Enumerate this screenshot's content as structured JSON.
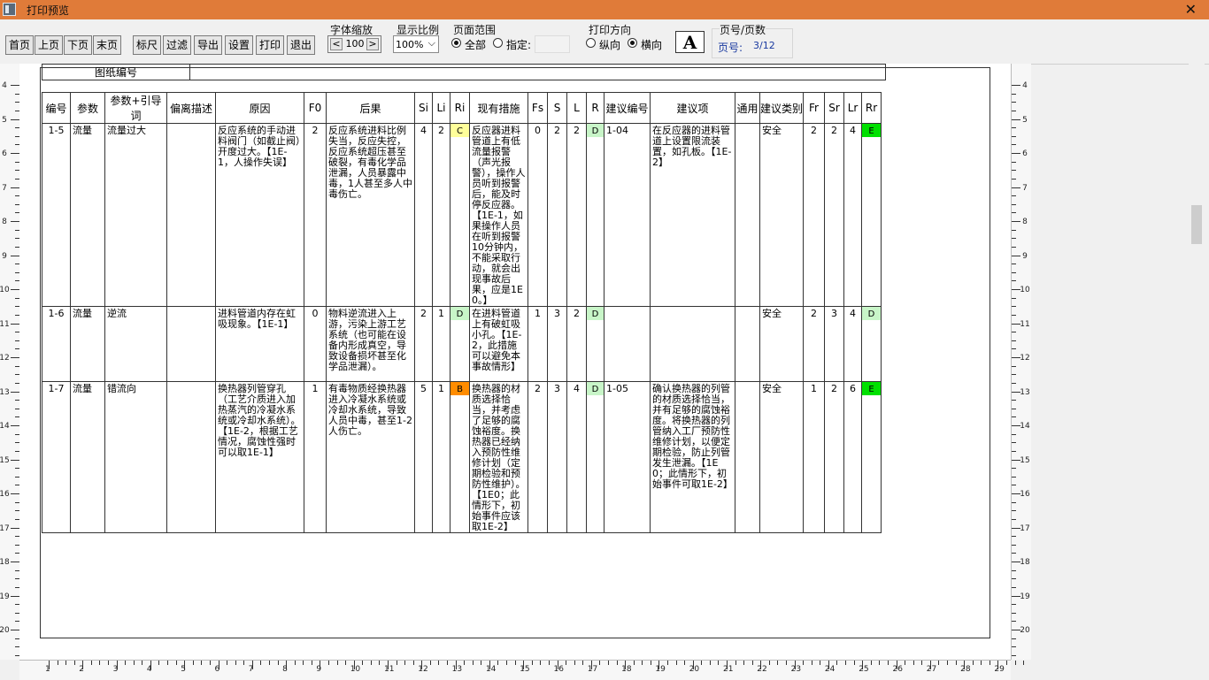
{
  "window": {
    "title": "打印预览"
  },
  "toolbar": {
    "buttons": [
      "首页",
      "上页",
      "下页",
      "末页",
      "标尺",
      "过滤",
      "导出",
      "设置",
      "打印",
      "退出"
    ],
    "font_scale": {
      "label": "字体缩放",
      "minus": "<",
      "value": "100",
      "plus": ">"
    },
    "zoom": {
      "label": "显示比例",
      "value": "100%"
    },
    "page_range": {
      "label": "页面范围",
      "all": "全部",
      "specified": "指定:",
      "specified_value": ""
    },
    "orientation": {
      "label": "打印方向",
      "portrait": "纵向",
      "landscape": "横向",
      "selected": "横向"
    },
    "font_icon": "A",
    "pages": {
      "label": "页号/页数",
      "key": "页号:",
      "value": "3/12"
    }
  },
  "drawing_no_label": "图纸编号",
  "columns": [
    "编号",
    "参数",
    "参数+引导词",
    "偏离描述",
    "原因",
    "F0",
    "后果",
    "Si",
    "Li",
    "Ri",
    "现有措施",
    "Fs",
    "S",
    "L",
    "R",
    "建议编号",
    "建议项",
    "通用",
    "建议类别",
    "Fr",
    "Sr",
    "Lr",
    "Rr"
  ],
  "rows": [
    {
      "id": "1-5",
      "param": "流量",
      "guide": "流量过大",
      "dev": "",
      "cause": "反应系统的手动进料阀门（如截止阀）开度过大。【1E-1，人操作失误】",
      "f0": "2",
      "consequence": "反应系统进料比例失当，反应失控，反应系统超压甚至破裂，有毒化学品泄漏，人员暴露中毒，1人甚至多人中毒伤亡。",
      "si": "4",
      "li": "2",
      "ri": "C",
      "measure": "反应器进料管道上有低流量报警（声光报警），操作人员听到报警后，能及时停反应器。【1E-1，如果操作人员在听到报警10分钟内，不能采取行动，就会出现事故后果，应是1E0。】",
      "fs": "0",
      "s": "2",
      "l": "2",
      "r": "D",
      "sug_no": "1-04",
      "suggestion": "在反应器的进料管道上设置限流装置，如孔板。【1E-2】",
      "general": "",
      "category": "安全",
      "fr": "2",
      "sr": "2",
      "lr": "4",
      "rr": "E"
    },
    {
      "id": "1-6",
      "param": "流量",
      "guide": "逆流",
      "dev": "",
      "cause": "进料管道内存在虹吸现象。【1E-1】",
      "f0": "0",
      "consequence": "物料逆流进入上游，污染上游工艺系统（也可能在设备内形成真空，导致设备损坏甚至化学品泄漏）。",
      "si": "2",
      "li": "1",
      "ri": "D",
      "measure": "在进料管道上有破虹吸小孔。【1E-2，此措施可以避免本事故情形】",
      "fs": "1",
      "s": "3",
      "l": "2",
      "r": "D",
      "sug_no": "",
      "suggestion": "",
      "general": "",
      "category": "安全",
      "fr": "2",
      "sr": "3",
      "lr": "4",
      "rr": "D"
    },
    {
      "id": "1-7",
      "param": "流量",
      "guide": "错流向",
      "dev": "",
      "cause": "换热器列管穿孔（工艺介质进入加热蒸汽的冷凝水系统或冷却水系统）。【1E-2，根据工艺情况，腐蚀性强时可以取1E-1】",
      "f0": "1",
      "consequence": "有毒物质经换热器进入冷凝水系统或冷却水系统，导致人员中毒，甚至1-2人伤亡。",
      "si": "5",
      "li": "1",
      "ri": "B",
      "measure": "换热器的材质选择恰当，并考虑了足够的腐蚀裕度。换热器已经纳入预防性维修计划（定期检验和预防性维护）。【1E0；此情形下，初始事件应该取1E-2】",
      "fs": "2",
      "s": "3",
      "l": "4",
      "r": "D",
      "sug_no": "1-05",
      "suggestion": "确认换热器的列管的材质选择恰当，并有足够的腐蚀裕度。将换热器的列管纳入工厂预防性维修计划，以便定期检验，防止列管发生泄漏。【1E0；此情形下，初始事件可取1E-2】",
      "general": "",
      "category": "安全",
      "fr": "1",
      "sr": "2",
      "lr": "6",
      "rr": "E"
    }
  ],
  "colors": {
    "titlebar": "#e07b39",
    "C": "#ffff9a",
    "B": "#ff8c00",
    "D": "#c8f5c8",
    "E": "#00e000"
  },
  "ruler": {
    "v_left": [
      "4",
      "5",
      "6",
      "7",
      "8",
      "9",
      "10",
      "11",
      "12",
      "13",
      "14",
      "15",
      "16",
      "17",
      "18",
      "19",
      "20"
    ],
    "h": [
      "1",
      "2",
      "3",
      "4",
      "5",
      "6",
      "7",
      "8",
      "9",
      "10",
      "11",
      "12",
      "13",
      "14",
      "15",
      "16",
      "17",
      "18",
      "19",
      "20",
      "21",
      "22",
      "23",
      "24",
      "25",
      "26",
      "27",
      "28",
      "29"
    ]
  }
}
